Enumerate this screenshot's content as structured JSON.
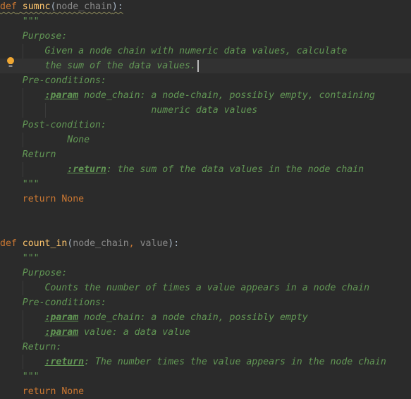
{
  "editor": {
    "functions": [
      {
        "name": "sumnc",
        "keyword_def": "def",
        "open_paren": "(",
        "params": [
          "node_chain"
        ],
        "close": "):",
        "docstring_open": "\"\"\"",
        "purpose_label": "Purpose:",
        "purpose_lines": [
          "Given a node chain with numeric data values, calculate",
          "the sum of the data values."
        ],
        "pre_label": "Pre-conditions:",
        "pre_params": [
          {
            "tag": ":param",
            "text": " node_chain: a node-chain, possibly empty, containing",
            "continuation": "numeric data values"
          }
        ],
        "post_label": "Post-condition:",
        "post_value": "None",
        "return_label": "Return",
        "return_tag": ":return",
        "return_text": ": the sum of the data values in the node chain",
        "docstring_close": "\"\"\"",
        "return_kw": "return",
        "return_val": "None"
      },
      {
        "name": "count_in",
        "keyword_def": "def",
        "open_paren": "(",
        "params": [
          "node_chain",
          "value"
        ],
        "param_sep": ", ",
        "close": "):",
        "docstring_open": "\"\"\"",
        "purpose_label": "Purpose:",
        "purpose_lines": [
          "Counts the number of times a value appears in a node chain"
        ],
        "pre_label": "Pre-conditions:",
        "pre_params": [
          {
            "tag": ":param",
            "text": " node_chain: a node chain, possibly empty"
          },
          {
            "tag": ":param",
            "text": " value: a data value"
          }
        ],
        "return_label": "Return:",
        "return_tag": ":return",
        "return_text": ": The number times the value appears in the node chain",
        "docstring_close": "\"\"\"",
        "return_kw": "return",
        "return_val": "None"
      }
    ],
    "colors": {
      "background": "#2b2b2b",
      "current_line": "#323232",
      "keyword": "#cc7832",
      "function_name": "#ffc66d",
      "parameter": "#8a8a8a",
      "docstring": "#629755",
      "bulb": "#f0a732"
    },
    "gutter_icon": "lightbulb-icon"
  }
}
